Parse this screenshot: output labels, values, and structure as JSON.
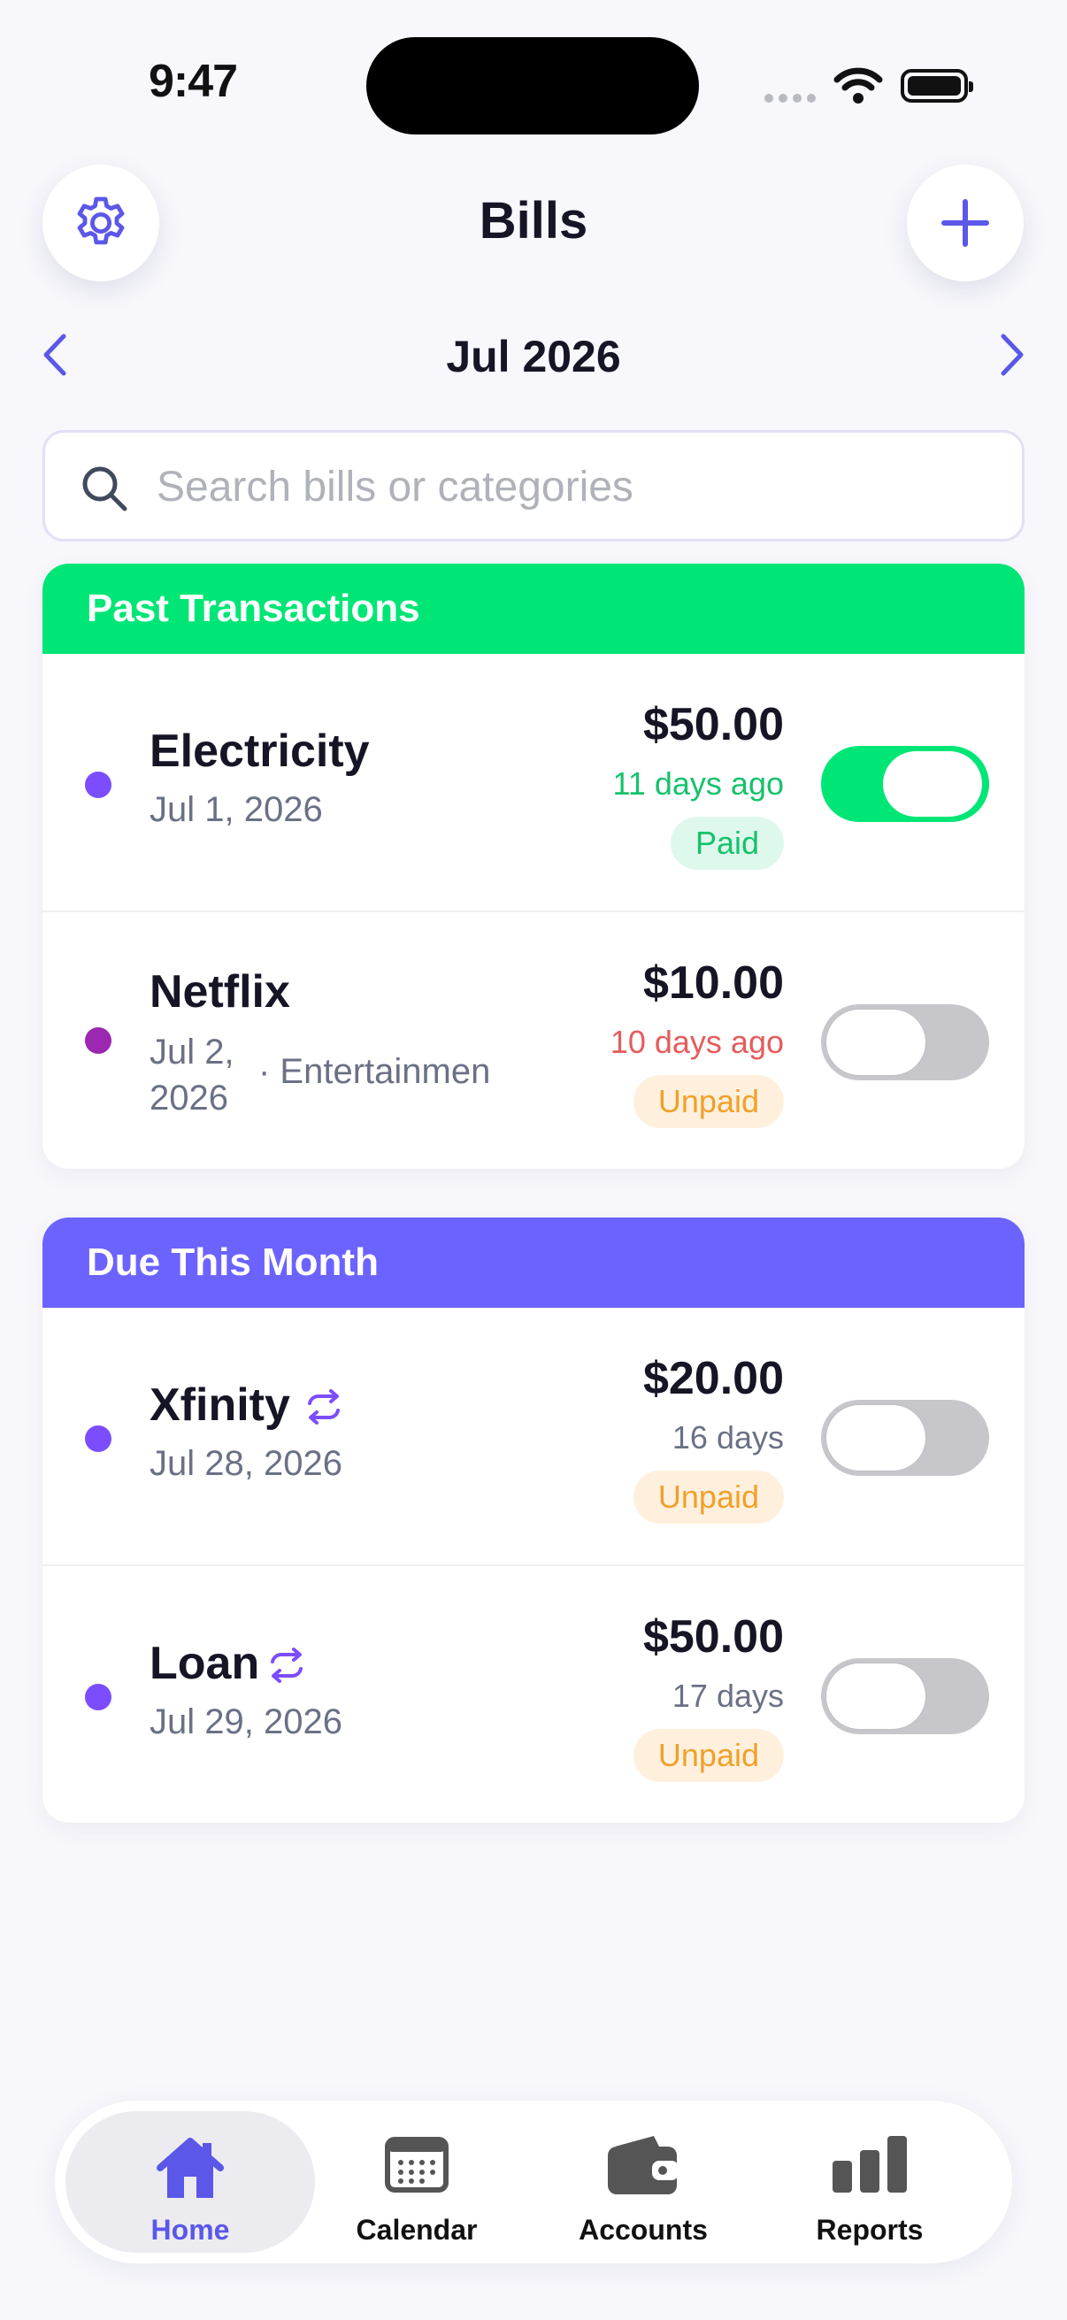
{
  "status_bar": {
    "time": "9:47"
  },
  "header": {
    "title": "Bills",
    "settings_icon": "gear-icon",
    "add_icon": "plus-icon",
    "accent_color": "#5b57e8"
  },
  "month_nav": {
    "label": "Jul 2026",
    "prev_icon": "chevron-left-icon",
    "next_icon": "chevron-right-icon"
  },
  "search": {
    "placeholder": "Search bills or categories",
    "value": ""
  },
  "sections": [
    {
      "title": "Past Transactions",
      "color": "#00e676",
      "bills": [
        {
          "name": "Electricity",
          "date": "Jul 1, 2026",
          "category": "",
          "amount": "$50.00",
          "relative": "11 days ago",
          "relative_color": "#16c26c",
          "status": "Paid",
          "toggled": true,
          "dot_color": "#7c4dff",
          "recurring": false
        },
        {
          "name": "Netflix",
          "date_line1": "Jul 2,",
          "date_line2": "2026",
          "category": "· Entertainmen",
          "amount": "$10.00",
          "relative": "10 days ago",
          "relative_color": "#e55c5c",
          "status": "Unpaid",
          "toggled": false,
          "dot_color": "#9c27b0",
          "recurring": false
        }
      ]
    },
    {
      "title": "Due This Month",
      "color": "#6c63ff",
      "bills": [
        {
          "name": "Xfinity",
          "date": "Jul 28, 2026",
          "amount": "$20.00",
          "relative": "16 days",
          "relative_color": "#6a7185",
          "status": "Unpaid",
          "toggled": false,
          "dot_color": "#7c4dff",
          "recurring": true
        },
        {
          "name": "Loan",
          "date": "Jul 29, 2026",
          "amount": "$50.00",
          "relative": "17 days",
          "relative_color": "#6a7185",
          "status": "Unpaid",
          "toggled": false,
          "dot_color": "#7c4dff",
          "recurring": true
        }
      ]
    }
  ],
  "tabs": [
    {
      "label": "Home",
      "icon": "house-icon",
      "active": true
    },
    {
      "label": "Calendar",
      "icon": "calendar-icon",
      "active": false
    },
    {
      "label": "Accounts",
      "icon": "wallet-icon",
      "active": false
    },
    {
      "label": "Reports",
      "icon": "bar-chart-icon",
      "active": false
    }
  ]
}
